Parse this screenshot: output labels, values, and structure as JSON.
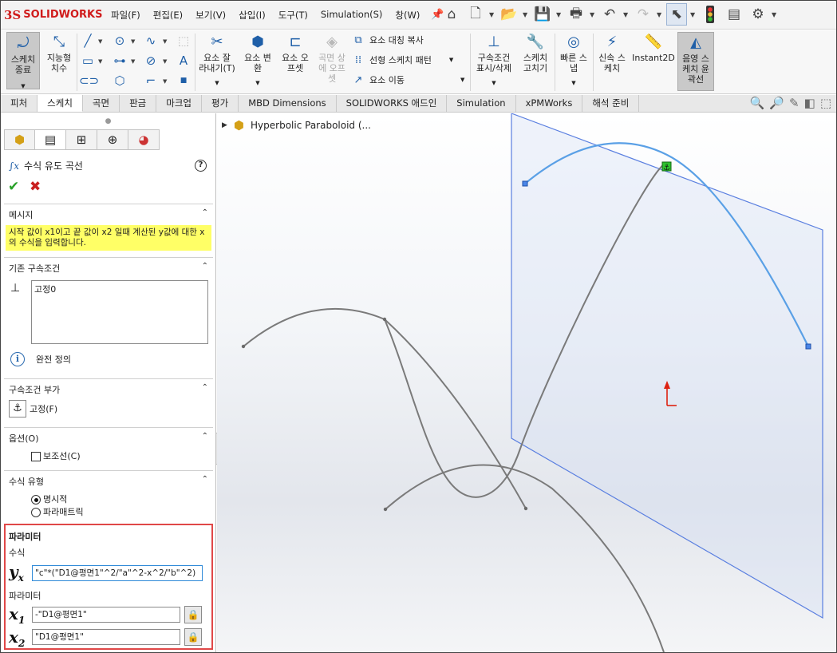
{
  "app": {
    "logo_prefix": "3S",
    "logo_text": "SOLIDWORKS"
  },
  "menu": [
    "파일(F)",
    "편집(E)",
    "보기(V)",
    "삽입(I)",
    "도구(T)",
    "Simulation(S)",
    "창(W)"
  ],
  "quick_icons": [
    "home-icon",
    "new-document-icon",
    "open-icon",
    "save-icon",
    "print-icon",
    "undo-icon",
    "redo-icon",
    "select-arrow-icon",
    "traffic-light-icon",
    "file-properties-icon",
    "options-gear-icon"
  ],
  "ribbon": {
    "exit_sketch": "스케치\n종료",
    "smart_dim": "지능형\n치수",
    "trim": "요소 잘\n라내기(T)",
    "convert": "요소 변\n환",
    "offset": "요소 오\n프셋",
    "surface_offset": "곡면 상\n에 오프\n셋",
    "mirror": "요소 대칭 복사",
    "linear_pattern": "선형 스케치 패턴",
    "move": "요소 이동",
    "relations": "구속조건\n표시/삭제",
    "repair": "스케치\n고치기",
    "quick_snap": "빠른 스\n냅",
    "rapid_sketch": "신속 스\n케치",
    "instant2d": "Instant2D",
    "shaded_contours": "음영 스\n케치 윤\n곽선"
  },
  "tabs": [
    "피처",
    "스케치",
    "곡면",
    "판금",
    "마크업",
    "평가",
    "MBD Dimensions",
    "SOLIDWORKS 애드인",
    "Simulation",
    "xPMWorks",
    "해석 준비"
  ],
  "active_tab": "스케치",
  "tree": {
    "label": "Hyperbolic Paraboloid (..."
  },
  "panel": {
    "title": "수식 유도 곡선",
    "message_header": "메시지",
    "message": "시작 값이 x1이고 끝 값이 x2 일때 계산된 y값에 대한 x의 수식을 입력합니다.",
    "existing_relations_header": "기존 구속조건",
    "relations_list": [
      "고정0"
    ],
    "status": "완전 정의",
    "add_relations_header": "구속조건 부가",
    "fix_label": "고정(F)",
    "options_header": "옵션(O)",
    "construction_label": "보조선(C)",
    "equation_type_header": "수식 유형",
    "explicit_label": "명시적",
    "parametric_label": "파라매트릭",
    "params_header": "파라미터",
    "equation_label": "수식",
    "y_value": "\"c\"*(\"D1@평면1\"^2/\"a\"^2-x^2/\"b\"^2)",
    "params_label": "파라미터",
    "x1_value": "-\"D1@평면1\"",
    "x2_value": "\"D1@평면1\""
  }
}
